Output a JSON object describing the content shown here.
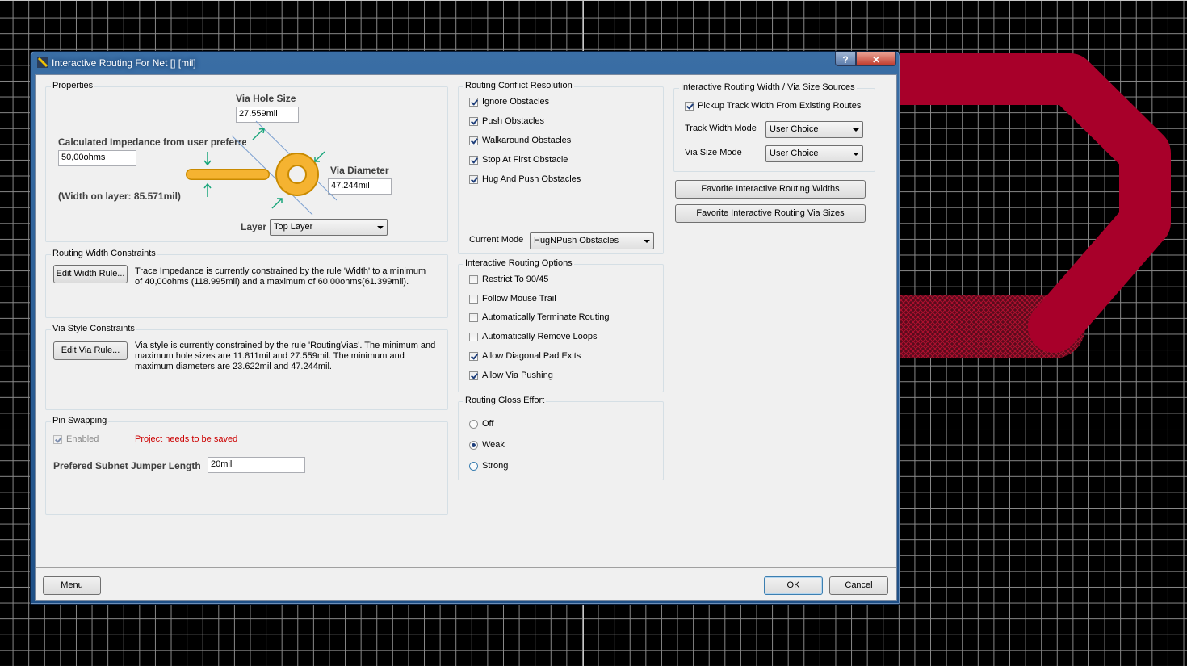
{
  "window": {
    "title": "Interactive Routing For Net [] [mil]",
    "help_glyph": "?",
    "close_glyph": "✕"
  },
  "properties": {
    "group_title": "Properties",
    "via_hole_size_label": "Via Hole Size",
    "via_hole_size_value": "27.559mil",
    "calc_impedance_label": "Calculated Impedance from user preferred",
    "calc_impedance_value": "50,00ohms",
    "width_on_layer": "(Width on layer: 85.571mil)",
    "via_diameter_label": "Via Diameter",
    "via_diameter_value": "47.244mil",
    "layer_label": "Layer",
    "layer_value": "Top Layer"
  },
  "routing_width_constraints": {
    "group_title": "Routing Width Constraints",
    "button": "Edit Width Rule...",
    "text": "Trace Impedance is currently constrained by the rule 'Width' to a minimum of 40,00ohms (118.995mil) and a maximum of 60,00ohms(61.399mil)."
  },
  "via_style_constraints": {
    "group_title": "Via Style Constraints",
    "button": "Edit Via Rule...",
    "text": "Via style is currently constrained by the rule 'RoutingVias'. The minimum and maximum hole sizes are 11.811mil and 27.559mil. The minimum and maximum diameters are 23.622mil and 47.244mil."
  },
  "pin_swapping": {
    "group_title": "Pin Swapping",
    "enabled_label": "Enabled",
    "warning": "Project needs to be saved",
    "subnet_label": "Prefered Subnet Jumper Length",
    "subnet_value": "20mil"
  },
  "conflict_resolution": {
    "group_title": "Routing Conflict Resolution",
    "options": [
      "Ignore Obstacles",
      "Push Obstacles",
      "Walkaround Obstacles",
      "Stop At First Obstacle",
      "Hug And Push Obstacles"
    ],
    "current_mode_label": "Current Mode",
    "current_mode_value": "HugNPush Obstacles"
  },
  "routing_options": {
    "group_title": "Interactive Routing Options",
    "options": [
      "Restrict To 90/45",
      "Follow Mouse Trail",
      "Automatically Terminate Routing",
      "Automatically Remove Loops",
      "Allow Diagonal Pad Exits",
      "Allow Via Pushing"
    ]
  },
  "gloss_effort": {
    "group_title": "Routing Gloss Effort",
    "options": [
      "Off",
      "Weak",
      "Strong"
    ],
    "selected": "Weak"
  },
  "size_sources": {
    "group_title": "Interactive Routing Width / Via Size Sources",
    "pickup_label": "Pickup Track Width From Existing Routes",
    "track_width_mode_label": "Track Width Mode",
    "track_width_mode_value": "User Choice",
    "via_size_mode_label": "Via Size Mode",
    "via_size_mode_value": "User Choice",
    "fav_widths_button": "Favorite Interactive Routing Widths",
    "fav_vias_button": "Favorite Interactive Routing Via Sizes"
  },
  "footer": {
    "menu_button": "Menu",
    "ok_button": "OK",
    "cancel_button": "Cancel"
  },
  "colors": {
    "track": "#a8002a",
    "via_ring": "#f5a623"
  }
}
